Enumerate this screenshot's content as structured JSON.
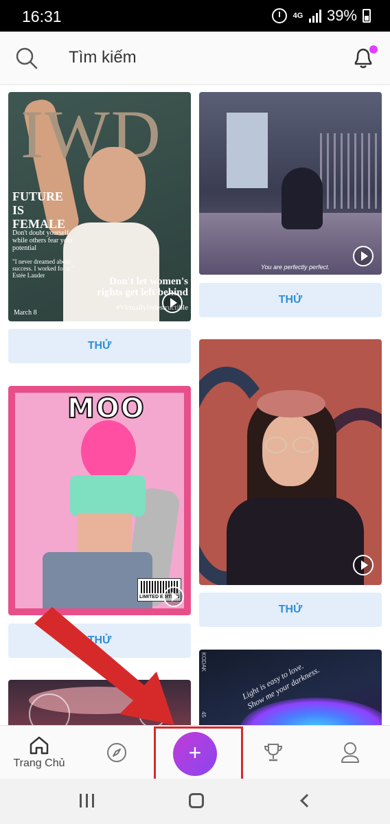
{
  "status_bar": {
    "time": "16:31",
    "network": "4G",
    "battery": "39%"
  },
  "header": {
    "search_label": "Tìm kiếm",
    "icons": [
      "search-icon",
      "bell-icon"
    ],
    "notification_dot_color": "#e040fb"
  },
  "feed": {
    "try_label": "THỬ",
    "cards": [
      {
        "title": "IWD",
        "headline": "FUTURE IS FEMALE",
        "subtext": "Don't doubt yourself while others fear your potential",
        "quote": "\"I never dreamed about success. I worked for it.\" Estée Lauder",
        "tagline": "Don't let women's rights get left behind",
        "hashtag": "#VirtuallyIndestructible",
        "date": "March 8",
        "has_video": true
      },
      {
        "caption": "You are perfectly perfect.",
        "has_video": true
      },
      {
        "title": "MOO",
        "badge": "LIMITED EDITION",
        "has_video": true
      },
      {
        "has_video": true
      },
      {
        "text_line_1": "Light is easy to love.",
        "text_line_2": "Show me your darkness.",
        "side_text_1": "KODAK",
        "side_text_2": "45"
      },
      {}
    ]
  },
  "bottom_nav": {
    "home_label": "Trang Chủ",
    "add_symbol": "+",
    "icons": [
      "home-icon",
      "compass-icon",
      "add-icon",
      "trophy-icon",
      "profile-icon"
    ]
  },
  "colors": {
    "accent_blue": "#2f8ed6",
    "try_button_bg": "#e3eefa",
    "fab_gradient_start": "#c03cd6",
    "fab_gradient_end": "#8b45f0",
    "annotation_red": "#d62a2a"
  }
}
